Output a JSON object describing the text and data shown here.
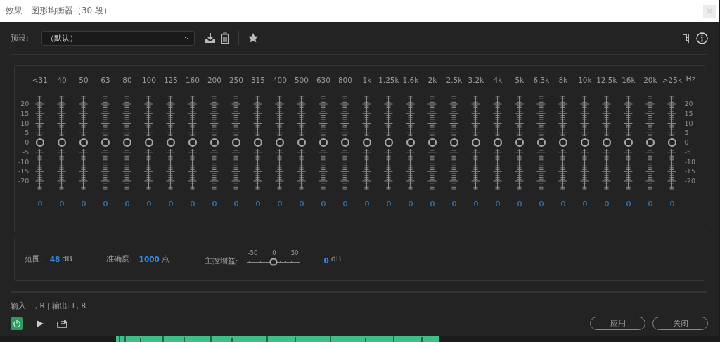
{
  "window": {
    "title": "效果 - 图形均衡器（30 段）"
  },
  "preset": {
    "label": "预设:",
    "value": "（默认）"
  },
  "eq": {
    "unit": "Hz",
    "left_scale": [
      "20",
      "15",
      "10",
      "5",
      "0",
      "-5",
      "-10",
      "-15",
      "-20"
    ],
    "right_scale": [
      "20",
      "15",
      "10",
      "5",
      "0",
      "-5",
      "-10",
      "-15",
      "-20"
    ],
    "bands": [
      {
        "label": "<31",
        "level": 0.5,
        "reading": "0"
      },
      {
        "label": "40",
        "level": 0.5,
        "reading": "0"
      },
      {
        "label": "50",
        "level": 0.5,
        "reading": "0"
      },
      {
        "label": "63",
        "level": 0.5,
        "reading": "0"
      },
      {
        "label": "80",
        "level": 0.5,
        "reading": "0"
      },
      {
        "label": "100",
        "level": 0.5,
        "reading": "0"
      },
      {
        "label": "125",
        "level": 0.5,
        "reading": "0"
      },
      {
        "label": "160",
        "level": 0.5,
        "reading": "0"
      },
      {
        "label": "200",
        "level": 0.5,
        "reading": "0"
      },
      {
        "label": "250",
        "level": 0.5,
        "reading": "0"
      },
      {
        "label": "315",
        "level": 0.5,
        "reading": "0"
      },
      {
        "label": "400",
        "level": 0.5,
        "reading": "0"
      },
      {
        "label": "500",
        "level": 0.5,
        "reading": "0"
      },
      {
        "label": "630",
        "level": 0.5,
        "reading": "0"
      },
      {
        "label": "800",
        "level": 0.5,
        "reading": "0"
      },
      {
        "label": "1k",
        "level": 0.5,
        "reading": "0"
      },
      {
        "label": "1.25k",
        "level": 0.5,
        "reading": "0"
      },
      {
        "label": "1.6k",
        "level": 0.5,
        "reading": "0"
      },
      {
        "label": "2k",
        "level": 0.5,
        "reading": "0"
      },
      {
        "label": "2.5k",
        "level": 0.5,
        "reading": "0"
      },
      {
        "label": "3.2k",
        "level": 0.5,
        "reading": "0"
      },
      {
        "label": "4k",
        "level": 0.5,
        "reading": "0"
      },
      {
        "label": "5k",
        "level": 0.5,
        "reading": "0"
      },
      {
        "label": "6.3k",
        "level": 0.5,
        "reading": "0"
      },
      {
        "label": "8k",
        "level": 0.5,
        "reading": "0"
      },
      {
        "label": "10k",
        "level": 0.5,
        "reading": "0"
      },
      {
        "label": "12.5k",
        "level": 0.5,
        "reading": "0"
      },
      {
        "label": "16k",
        "level": 0.5,
        "reading": "0"
      },
      {
        "label": "20k",
        "level": 0.5,
        "reading": "0"
      },
      {
        "label": ">25k",
        "level": 0.5,
        "reading": "0"
      }
    ]
  },
  "settings": {
    "range": {
      "label": "范围:",
      "value": "48",
      "unit": "dB"
    },
    "accuracy": {
      "label": "准确度:",
      "value": "1000",
      "unit": "点"
    },
    "master_gain": {
      "label": "主控增益:",
      "ticks": [
        "-50",
        "0",
        "50"
      ],
      "level": 0.5,
      "value": "0",
      "unit": "dB"
    }
  },
  "io": "输入: L, R | 输出: L, R",
  "power": {
    "on": true
  },
  "buttons": [
    "应用",
    "关闭"
  ]
}
